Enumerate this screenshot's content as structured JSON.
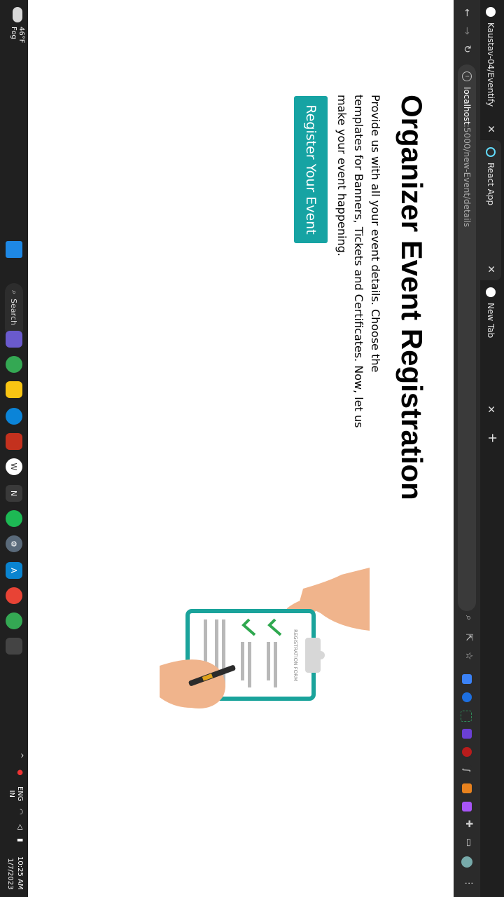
{
  "browser": {
    "tabs": [
      {
        "label": "Kaustav-04/Eventify",
        "icon": "github-icon"
      },
      {
        "label": "React App",
        "icon": "react-icon",
        "active": true
      },
      {
        "label": "New Tab",
        "icon": "chrome-icon"
      }
    ],
    "url": {
      "host": "localhost",
      "path": ":5000/new-Event/details"
    }
  },
  "page": {
    "title": "Organizer Event Registration",
    "description": "Provide us with all your event details. Choose the templates for Banners, Tickets and Certificates. Now, let us make your event happening.",
    "cta_label": "Register Your Event",
    "illustration_text": "REGISTRATION FORM"
  },
  "taskbar": {
    "weather_temp": "46°F",
    "weather_cond": "Fog",
    "search_label": "Search",
    "language": "ENG",
    "region": "IN",
    "time": "10:25 AM",
    "date": "1/7/2023"
  },
  "colors": {
    "accent": "#16a3a3",
    "clipboard": "#1aa39b"
  }
}
